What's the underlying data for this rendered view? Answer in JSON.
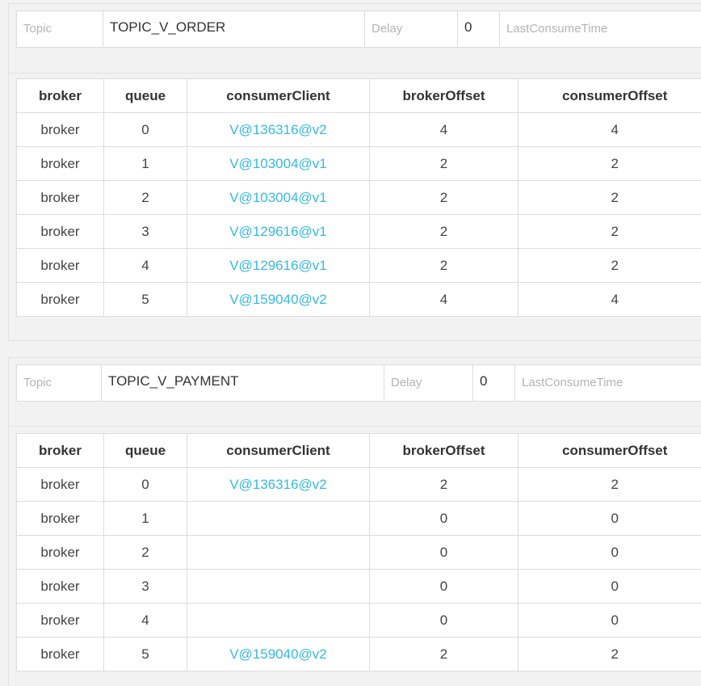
{
  "labels": {
    "topic": "Topic",
    "delay": "Delay",
    "last_consume_time": "LastConsumeTime"
  },
  "columns": [
    "broker",
    "queue",
    "consumerClient",
    "brokerOffset",
    "consumerOffset"
  ],
  "colors": {
    "client_link": "#35b9e3",
    "label_gray": "#b4b4b4",
    "background": "#f2f2f2"
  },
  "panels": [
    {
      "topic": "TOPIC_V_ORDER",
      "delay": "0",
      "last_consume_time": "",
      "rows": [
        {
          "broker": "broker",
          "queue": "0",
          "client": "V@136316@v2",
          "broker_offset": "4",
          "consumer_offset": "4"
        },
        {
          "broker": "broker",
          "queue": "1",
          "client": "V@103004@v1",
          "broker_offset": "2",
          "consumer_offset": "2"
        },
        {
          "broker": "broker",
          "queue": "2",
          "client": "V@103004@v1",
          "broker_offset": "2",
          "consumer_offset": "2"
        },
        {
          "broker": "broker",
          "queue": "3",
          "client": "V@129616@v1",
          "broker_offset": "2",
          "consumer_offset": "2"
        },
        {
          "broker": "broker",
          "queue": "4",
          "client": "V@129616@v1",
          "broker_offset": "2",
          "consumer_offset": "2"
        },
        {
          "broker": "broker",
          "queue": "5",
          "client": "V@159040@v2",
          "broker_offset": "4",
          "consumer_offset": "4"
        }
      ]
    },
    {
      "topic": "TOPIC_V_PAYMENT",
      "delay": "0",
      "last_consume_time": "",
      "rows": [
        {
          "broker": "broker",
          "queue": "0",
          "client": "V@136316@v2",
          "broker_offset": "2",
          "consumer_offset": "2"
        },
        {
          "broker": "broker",
          "queue": "1",
          "client": "",
          "broker_offset": "0",
          "consumer_offset": "0"
        },
        {
          "broker": "broker",
          "queue": "2",
          "client": "",
          "broker_offset": "0",
          "consumer_offset": "0"
        },
        {
          "broker": "broker",
          "queue": "3",
          "client": "",
          "broker_offset": "0",
          "consumer_offset": "0"
        },
        {
          "broker": "broker",
          "queue": "4",
          "client": "",
          "broker_offset": "0",
          "consumer_offset": "0"
        },
        {
          "broker": "broker",
          "queue": "5",
          "client": "V@159040@v2",
          "broker_offset": "2",
          "consumer_offset": "2"
        }
      ]
    }
  ]
}
